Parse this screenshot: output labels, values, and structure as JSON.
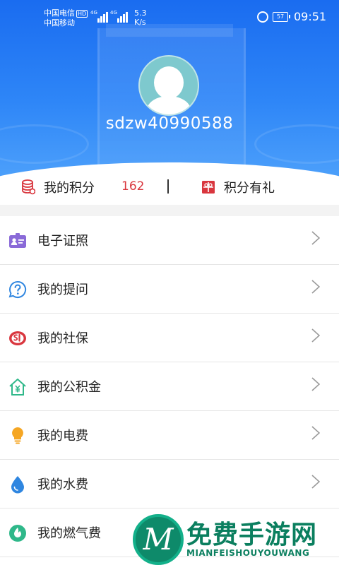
{
  "status_bar": {
    "carrier_1": "中国电信",
    "carrier_1_badge": "HD",
    "carrier_2": "中国移动",
    "network_1": "4G",
    "network_2": "4G",
    "speed_value": "5.3",
    "speed_unit": "K/s",
    "battery": "57",
    "time": "09:51"
  },
  "profile": {
    "username": "sdzw40990588"
  },
  "points": {
    "my_points_label": "我的积分",
    "my_points_value": "162",
    "rewards_label": "积分有礼"
  },
  "menu": {
    "items": [
      {
        "label": "电子证照",
        "icon": "id-card-icon",
        "color": "#8a6ad8"
      },
      {
        "label": "我的提问",
        "icon": "question-bubble-icon",
        "color": "#2f86e0"
      },
      {
        "label": "我的社保",
        "icon": "social-security-icon",
        "color": "#d9363e"
      },
      {
        "label": "我的公积金",
        "icon": "housing-fund-icon",
        "color": "#2fb88a"
      },
      {
        "label": "我的电费",
        "icon": "lightbulb-icon",
        "color": "#f5a623"
      },
      {
        "label": "我的水费",
        "icon": "water-drop-icon",
        "color": "#2f86e0"
      },
      {
        "label": "我的燃气费",
        "icon": "flame-icon",
        "color": "#2fb88a"
      }
    ]
  },
  "watermark": {
    "logo_letter": "M",
    "title": "免费手游网",
    "subtitle": "MIANFEISHOUYOUWANG"
  },
  "colors": {
    "header_blue": "#1a6cf0",
    "accent_red": "#d9363e"
  }
}
